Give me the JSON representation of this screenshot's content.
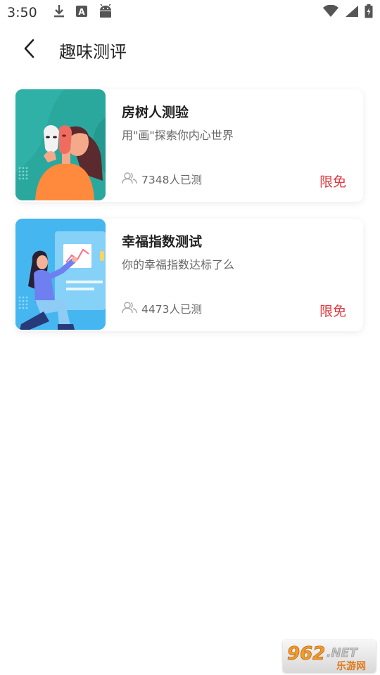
{
  "status_bar": {
    "time": "3:50",
    "left_icons": [
      "download-icon",
      "a-box-icon",
      "android-icon"
    ],
    "right_icons": [
      "wifi-icon",
      "signal-icon",
      "battery-charging-icon"
    ]
  },
  "header": {
    "back_icon": "chevron-left-icon",
    "title": "趣味测评"
  },
  "cards": [
    {
      "title": "房树人测验",
      "subtitle": "用\"画\"探索你内心世界",
      "participants": "7348人已测",
      "badge": "限免",
      "thumb_bg": "#2aa89e"
    },
    {
      "title": "幸福指数测试",
      "subtitle": "你的幸福指数达标了么",
      "participants": "4473人已测",
      "badge": "限免",
      "thumb_bg": "#45b6f0"
    }
  ],
  "watermark": {
    "logo_number": "962",
    "logo_suffix": ".NET",
    "logo_cn": "乐游网"
  },
  "colors": {
    "accent_red": "#e0393e",
    "text_primary": "#222222",
    "text_secondary": "#666666"
  }
}
